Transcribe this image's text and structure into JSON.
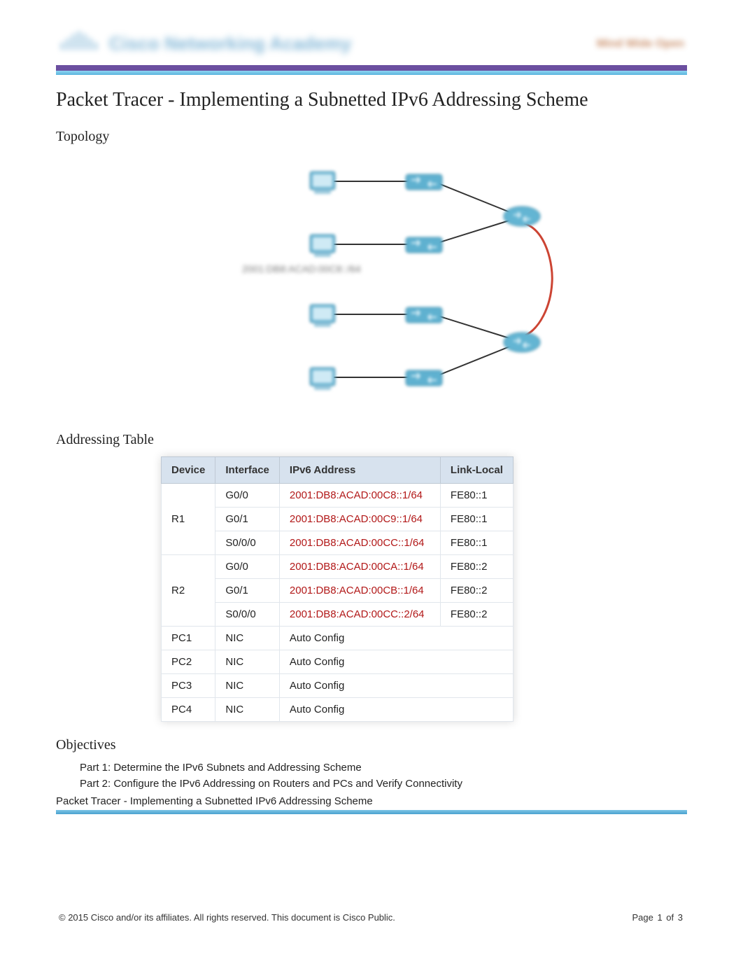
{
  "header": {
    "brand": "Cisco Networking Academy",
    "tagline": "Mind Wide Open"
  },
  "title": "Packet Tracer - Implementing a Subnetted IPv6 Addressing Scheme",
  "sections": {
    "topology": "Topology",
    "addressing_table": "Addressing Table",
    "objectives": "Objectives"
  },
  "topology_label": "2001:DB8:ACAD:00C8::/64",
  "table": {
    "headers": [
      "Device",
      "Interface",
      "IPv6 Address",
      "Link-Local"
    ],
    "rows": [
      {
        "device": "R1",
        "iface": "G0/0",
        "addr": "2001:DB8:ACAD:00C8::1/64",
        "ll": "FE80::1",
        "addr_red": true
      },
      {
        "device": "",
        "iface": "G0/1",
        "addr": "2001:DB8:ACAD:00C9::1/64",
        "ll": "FE80::1",
        "addr_red": true
      },
      {
        "device": "",
        "iface": "S0/0/0",
        "addr": "2001:DB8:ACAD:00CC::1/64",
        "ll": "FE80::1",
        "addr_red": true
      },
      {
        "device": "R2",
        "iface": "G0/0",
        "addr": "2001:DB8:ACAD:00CA::1/64",
        "ll": "FE80::2",
        "addr_red": true
      },
      {
        "device": "",
        "iface": "G0/1",
        "addr": "2001:DB8:ACAD:00CB::1/64",
        "ll": "FE80::2",
        "addr_red": true
      },
      {
        "device": "",
        "iface": "S0/0/0",
        "addr": "2001:DB8:ACAD:00CC::2/64",
        "ll": "FE80::2",
        "addr_red": true
      },
      {
        "device": "PC1",
        "iface": "NIC",
        "addr": "Auto Config",
        "ll": "",
        "addr_red": false
      },
      {
        "device": "PC2",
        "iface": "NIC",
        "addr": "Auto Config",
        "ll": "",
        "addr_red": false
      },
      {
        "device": "PC3",
        "iface": "NIC",
        "addr": "Auto Config",
        "ll": "",
        "addr_red": false
      },
      {
        "device": "PC4",
        "iface": "NIC",
        "addr": "Auto Config",
        "ll": "",
        "addr_red": false
      }
    ],
    "rowspans": {
      "R1": 3,
      "R2": 3
    }
  },
  "objectives": [
    "Part 1: Determine the IPv6 Subnets and Addressing Scheme",
    "Part 2: Configure the IPv6 Addressing on Routers and PCs and Verify Connectivity"
  ],
  "running_title": "Packet Tracer - Implementing a Subnetted IPv6 Addressing Scheme",
  "footer": {
    "copyright": "© 2015 Cisco and/or its affiliates. All rights reserved. This document is Cisco Public.",
    "page_label": "Page",
    "page_current": "1",
    "page_of": "of",
    "page_total": "3"
  },
  "icons": {
    "pc": "pc-icon",
    "switch": "switch-icon",
    "router": "router-icon"
  }
}
